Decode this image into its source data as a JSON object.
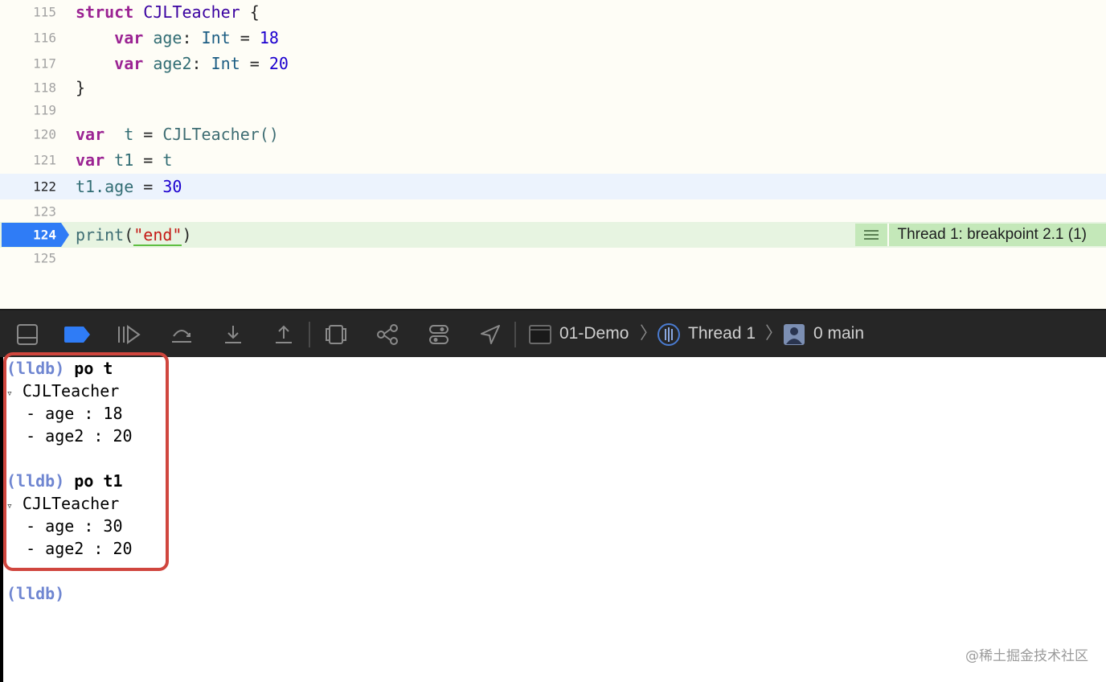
{
  "editor": {
    "lines": [
      {
        "num": "115"
      },
      {
        "num": "116"
      },
      {
        "num": "117"
      },
      {
        "num": "118"
      },
      {
        "num": "119"
      },
      {
        "num": "120"
      },
      {
        "num": "121"
      },
      {
        "num": "122"
      },
      {
        "num": "123"
      },
      {
        "num": "124"
      },
      {
        "num": "125"
      }
    ],
    "tokens": {
      "l115_kw": "struct",
      "l115_name": "CJLTeacher",
      "l115_brace": " {",
      "l116_kw": "var",
      "l116_var": "age",
      "l116_colon": ": ",
      "l116_type": "Int",
      "l116_eq": " = ",
      "l116_val": "18",
      "l117_kw": "var",
      "l117_var": "age2",
      "l117_colon": ": ",
      "l117_type": "Int",
      "l117_eq": " = ",
      "l117_val": "20",
      "l118_brace": "}",
      "l120_kw": "var",
      "l120_var": "t",
      "l120_eq": " = ",
      "l120_call": "CJLTeacher()",
      "l121_kw": "var",
      "l121_var": "t1",
      "l121_eq": " = ",
      "l121_rhs": "t",
      "l122_lhs": "t1.age",
      "l122_eq": " = ",
      "l122_val": "30",
      "l124_fn": "print",
      "l124_open": "(",
      "l124_str": "\"end\"",
      "l124_close": ")"
    },
    "breakpoint_label": "Thread 1: breakpoint 2.1 (1)"
  },
  "debugbar": {
    "process": "01-Demo",
    "thread": "Thread 1",
    "frame": "0 main"
  },
  "console": {
    "prompt": "(lldb)",
    "cmd1": " po t",
    "type1": " CJLTeacher",
    "field1a": "  - age : 18",
    "field1b": "  - age2 : 20",
    "cmd2": " po t1",
    "type2": " CJLTeacher",
    "field2a": "  - age : 30",
    "field2b": "  - age2 : 20",
    "disclosure": "▿"
  },
  "watermark": "@稀土掘金技术社区",
  "colors": {
    "editor_bg": "#fefdf6",
    "current_line": "#ecf3fd",
    "breakpoint_line": "#e7f4e1",
    "breakpoint_marker": "#2f7cf6",
    "highlight_box": "#d0463e",
    "lldb_prompt": "#6f86d1"
  }
}
